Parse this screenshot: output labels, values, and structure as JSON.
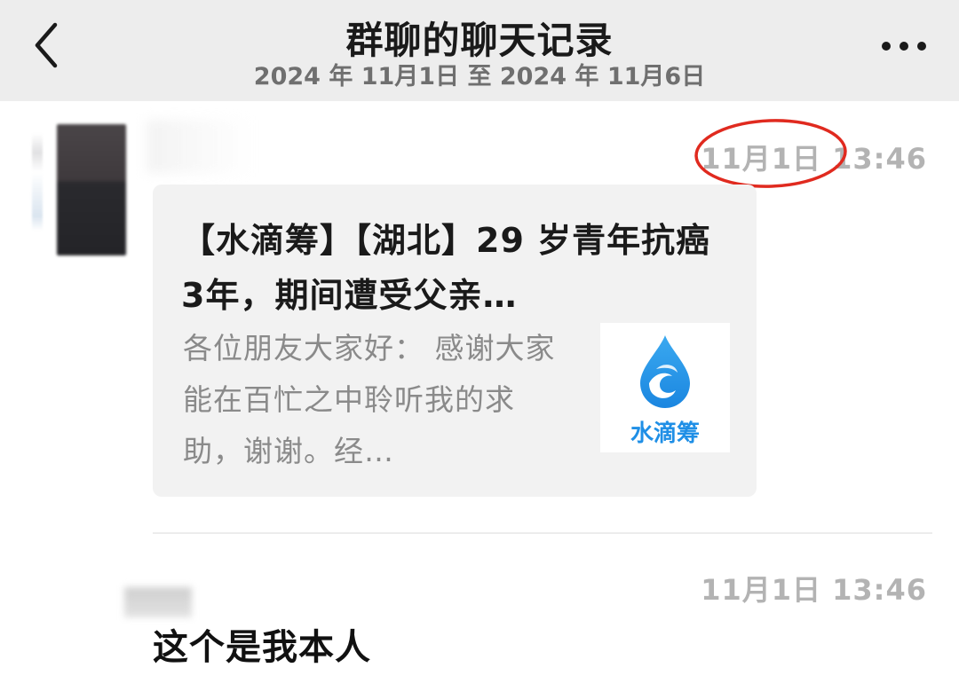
{
  "header": {
    "title": "群聊的聊天记录",
    "date_range": "2024 年 11月1日 至 2024 年 11月6日",
    "back_icon": "chevron-left-icon",
    "more_icon": "more-horizontal-icon"
  },
  "messages": [
    {
      "time": "11月1日 13:46",
      "card": {
        "title": "【水滴筹】【湖北】29 岁青年抗癌 3年，期间遭受父亲…",
        "description": "各位朋友大家好： 感谢大家能在百忙之中聆听我的求助，谢谢。经…",
        "logo_text": "水滴筹",
        "logo_icon": "water-drop-logo-icon"
      },
      "annotation": "red-ellipse-highlight"
    },
    {
      "time": "11月1日 13:46",
      "text": "这个是我本人"
    }
  ],
  "colors": {
    "header_bg": "#ededed",
    "card_bg": "#f2f2f2",
    "accent_blue": "#1f8fe6",
    "annotation_red": "#e02a1f",
    "timestamp_gray": "#b3b3b3"
  }
}
